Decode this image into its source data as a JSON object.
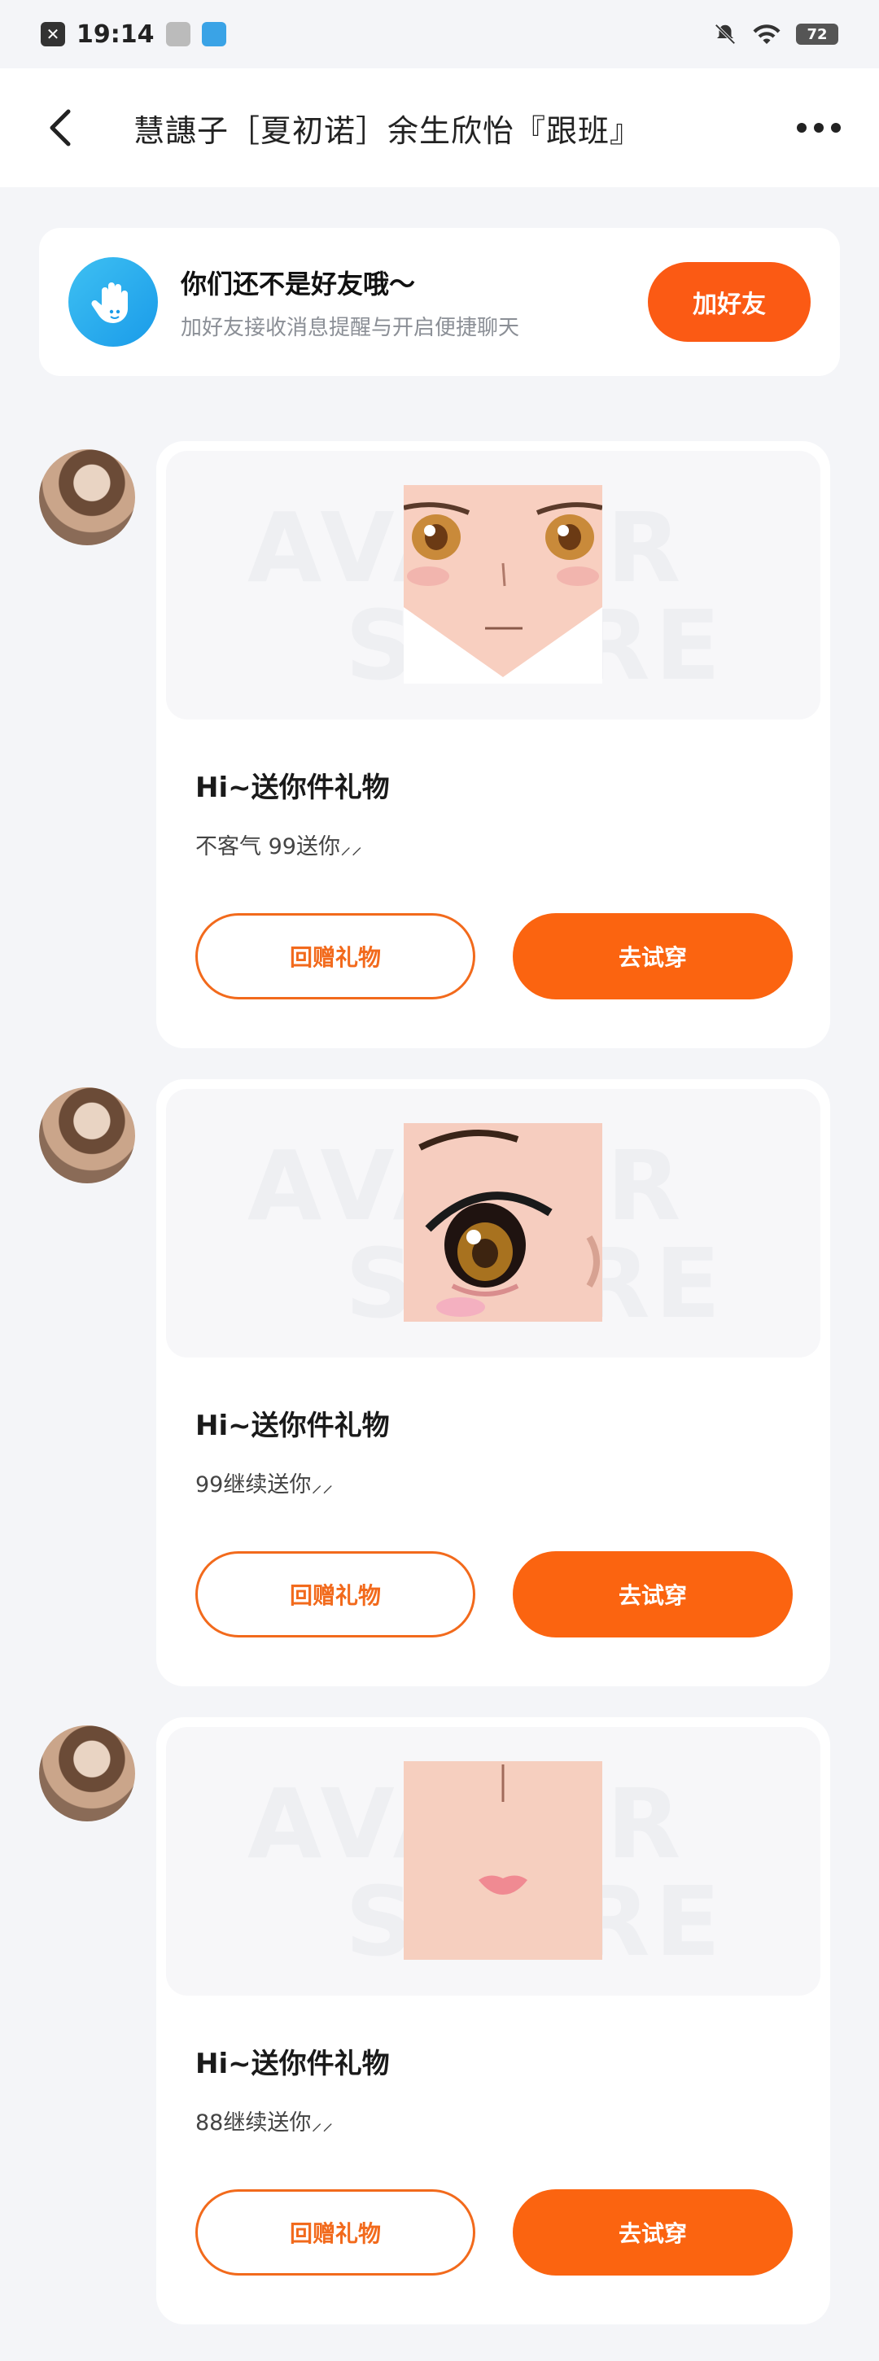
{
  "status_bar": {
    "time": "19:14",
    "battery": "72"
  },
  "header": {
    "title": "慧譓子［夏初诺］余生欣怡『跟班』"
  },
  "friend_banner": {
    "title": "你们还不是好友哦～",
    "subtitle": "加好友接收消息提醒与开启便捷聊天",
    "button_label": "加好友"
  },
  "watermark": {
    "line1": "AVATAR",
    "line2": "STORE"
  },
  "messages": [
    {
      "title": "Hi~送你件礼物",
      "text": "不客气  99送你⸝⸝",
      "return_label": "回赠礼物",
      "try_label": "去试穿",
      "thumb": "face-thumbnail"
    },
    {
      "title": "Hi~送你件礼物",
      "text": "99继续送你⸝⸝",
      "return_label": "回赠礼物",
      "try_label": "去试穿",
      "thumb": "eye-thumbnail"
    },
    {
      "title": "Hi~送你件礼物",
      "text": "88继续送你⸝⸝",
      "return_label": "回赠礼物",
      "try_label": "去试穿",
      "thumb": "lips-thumbnail"
    }
  ],
  "colors": {
    "accent": "#fb6410",
    "banner_icon": "#1a9be9",
    "background": "#f4f5f8"
  }
}
